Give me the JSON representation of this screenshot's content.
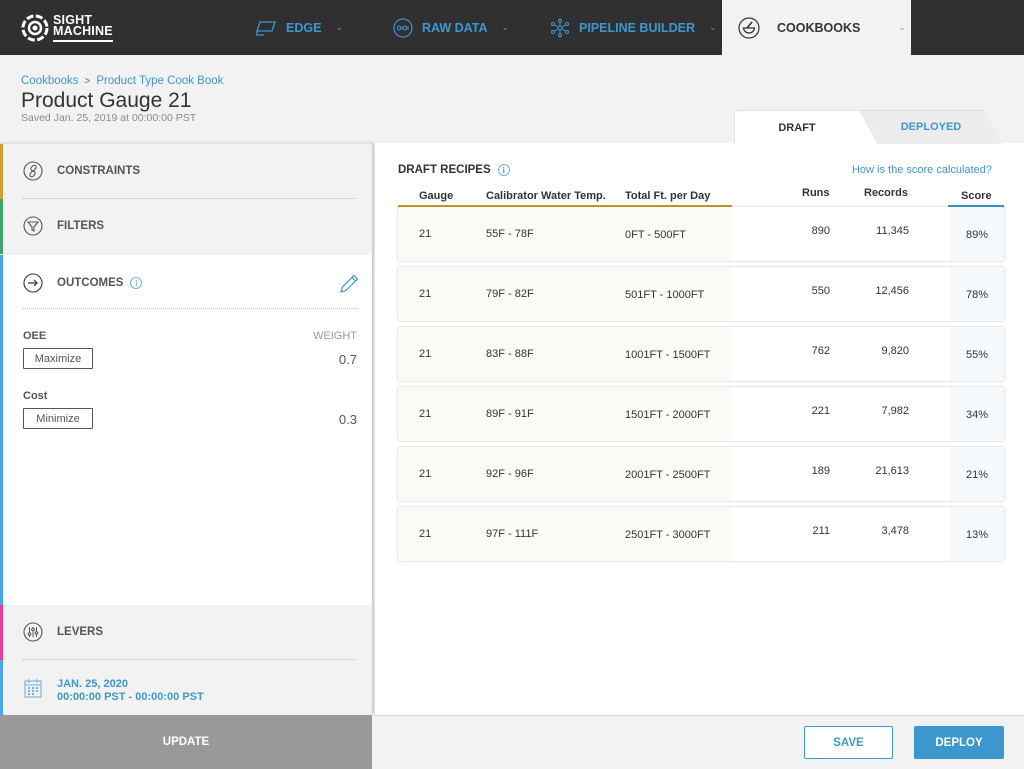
{
  "app": {
    "brand_line1": "SIGHT",
    "brand_line2": "MACHINE"
  },
  "nav": {
    "items": [
      {
        "label": "EDGE",
        "icon": "edge-icon"
      },
      {
        "label": "RAW DATA",
        "icon": "raw-data-icon"
      },
      {
        "label": "PIPELINE BUILDER",
        "icon": "pipeline-icon"
      },
      {
        "label": "COOKBOOKS",
        "icon": "mortar-pestle-icon",
        "active": true
      }
    ],
    "chevron": "⌄"
  },
  "header": {
    "breadcrumb": [
      "Cookbooks",
      "Product Type Cook Book"
    ],
    "breadcrumb_separator": ">",
    "title": "Product Gauge 21",
    "saved": "Saved Jan. 25, 2019 at 00:00:00 PST"
  },
  "tabs": [
    {
      "label": "DRAFT",
      "active": true
    },
    {
      "label": "DEPLOYED",
      "active": false
    }
  ],
  "sidebar": {
    "constraints": {
      "label": "CONSTRAINTS",
      "color": "#d4a22b"
    },
    "filters": {
      "label": "FILTERS",
      "color": "#3ea46e"
    },
    "outcomes": {
      "label": "OUTCOMES",
      "color": "#4aa3f0",
      "weight_label": "WEIGHT",
      "items": [
        {
          "name": "OEE",
          "goal": "Maximize",
          "weight": "0.7"
        },
        {
          "name": "Cost",
          "goal": "Minimize",
          "weight": "0.3"
        }
      ]
    },
    "levers": {
      "label": "LEVERS",
      "color": "#ee3d96"
    },
    "date_range": {
      "date": "JAN. 25, 2020",
      "time": "00:00:00 PST - 00:00:00 PST",
      "color": "#4aa3f0"
    },
    "update_label": "UPDATE"
  },
  "recipes": {
    "title": "DRAFT RECIPES",
    "score_link": "How is the score calculated?",
    "columns": [
      "Gauge",
      "Calibrator Water Temp.",
      "Total Ft. per Day",
      "Runs",
      "Records",
      "Score"
    ],
    "rows": [
      {
        "gauge": "21",
        "temp": "55F - 78F",
        "feet": "0FT - 500FT",
        "runs": "890",
        "records": "11,345",
        "score": "89%"
      },
      {
        "gauge": "21",
        "temp": "79F - 82F",
        "feet": "501FT - 1000FT",
        "runs": "550",
        "records": "12,456",
        "score": "78%"
      },
      {
        "gauge": "21",
        "temp": "83F - 88F",
        "feet": "1001FT - 1500FT",
        "runs": "762",
        "records": "9,820",
        "score": "55%"
      },
      {
        "gauge": "21",
        "temp": "89F - 91F",
        "feet": "1501FT - 2000FT",
        "runs": "221",
        "records": "7,982",
        "score": "34%"
      },
      {
        "gauge": "21",
        "temp": "92F - 96F",
        "feet": "2001FT - 2500FT",
        "runs": "189",
        "records": "21,613",
        "score": "21%"
      },
      {
        "gauge": "21",
        "temp": "97F - 111F",
        "feet": "2501FT - 3000FT",
        "runs": "211",
        "records": "3,478",
        "score": "13%"
      }
    ]
  },
  "footer": {
    "save_label": "SAVE",
    "deploy_label": "DEPLOY"
  }
}
